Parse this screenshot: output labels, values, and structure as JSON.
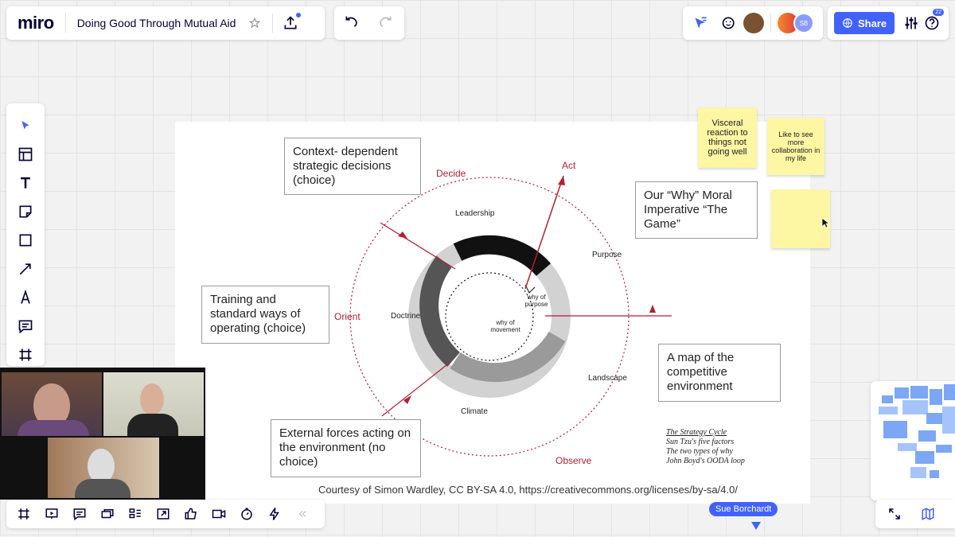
{
  "app": {
    "logo": "miro",
    "board_title": "Doing Good Through Mutual Aid"
  },
  "header": {
    "share_label": "Share",
    "help_badge": "22",
    "avatar_initials": "SB"
  },
  "colors": {
    "accent": "#4262ff",
    "sticky": "#fdf6a3",
    "cycle_red": "#b02030"
  },
  "diagram": {
    "notes": {
      "context": "Context- dependent strategic decisions (choice)",
      "why": "Our “Why” Moral Imperative “The Game”",
      "training": "Training and standard ways of operating (choice)",
      "map": "A map of the competitive environment",
      "external": "External forces acting on the environment (no choice)"
    },
    "ooda": {
      "decide": "Decide",
      "act": "Act",
      "orient": "Orient",
      "observe": "Observe"
    },
    "factors": {
      "leadership": "Leadership",
      "purpose": "Purpose",
      "doctrine": "Doctrine",
      "landscape": "Landscape",
      "climate": "Climate"
    },
    "inner": {
      "why_purpose": "why of purpose",
      "why_movement": "why of movement"
    },
    "strategy": {
      "title": "The Strategy Cycle",
      "line1": "Sun Tzu's five factors",
      "line2": "The two types of why",
      "line3": "John Boyd's OODA loop"
    },
    "credit": "Courtesy of Simon Wardley, CC BY-SA 4.0, https://creativecommons.org/licenses/by-sa/4.0/"
  },
  "stickies": {
    "s1": "Visceral reaction to things not going well",
    "s2": "Like to see more collaboration in my life",
    "s3": ""
  },
  "cursor": {
    "name": "Sue Borchardt"
  }
}
